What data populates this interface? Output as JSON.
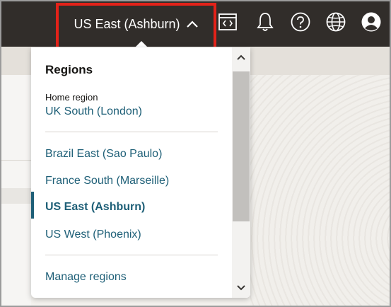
{
  "header": {
    "region_button_label": "US East (Ashburn)",
    "icons": [
      "code-editor-icon",
      "bell-icon",
      "help-icon",
      "globe-icon",
      "user-avatar-icon"
    ]
  },
  "regions_menu": {
    "title": "Regions",
    "home_label": "Home region",
    "home_region": "UK South (London)",
    "regions": [
      {
        "label": "Brazil East (Sao Paulo)",
        "active": false
      },
      {
        "label": "France South (Marseille)",
        "active": false
      },
      {
        "label": "US East (Ashburn)",
        "active": true
      },
      {
        "label": "US West (Phoenix)",
        "active": false
      }
    ],
    "manage_label": "Manage regions"
  },
  "colors": {
    "header_bg": "#312d2a",
    "link": "#1e5f77",
    "highlight_box": "#e32219"
  }
}
